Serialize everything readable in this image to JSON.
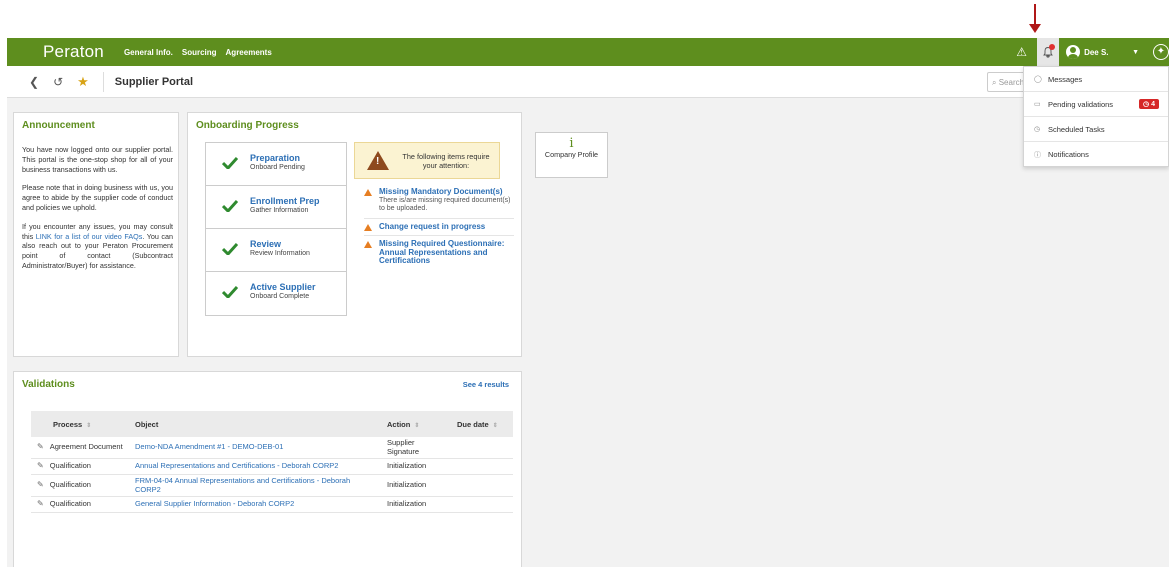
{
  "annotation": {
    "arrow_color": "#b01818"
  },
  "header": {
    "brand": "Peraton",
    "nav": [
      "General Info.",
      "Sourcing",
      "Agreements"
    ],
    "user_name": "Dee S.",
    "accent": "#5e8e1e"
  },
  "subbar": {
    "title": "Supplier Portal",
    "search_placeholder": "Search"
  },
  "announcement": {
    "title": "Announcement",
    "p1": "You have now logged onto our supplier portal. This portal is the one-stop shop for all of your business transactions with us.",
    "p2": "Please note that in doing business with us, you agree to abide by the supplier code of conduct and policies we uphold.",
    "p3_before": "If you encounter any issues, you may consult this ",
    "p3_link": "LINK for a list of our video FAQs",
    "p3_after": ". You can also reach out to your Peraton Procurement point of contact (Subcontract Administrator/Buyer) for assistance."
  },
  "onboarding": {
    "title": "Onboarding Progress",
    "steps": [
      {
        "name": "Preparation",
        "sub": "Onboard Pending"
      },
      {
        "name": "Enrollment Prep",
        "sub": "Gather Information"
      },
      {
        "name": "Review",
        "sub": "Review Information"
      },
      {
        "name": "Active Supplier",
        "sub": "Onboard Complete"
      }
    ],
    "attention_text": "The following items require your attention:",
    "attention_items": [
      {
        "title": "Missing Mandatory Document(s)",
        "desc": "There is/are missing required document(s) to be uploaded."
      },
      {
        "title": "Change request in progress",
        "desc": ""
      },
      {
        "title": "Missing Required Questionnaire: Annual Representations and Certifications",
        "desc": ""
      }
    ]
  },
  "company_profile": {
    "label": "Company Profile"
  },
  "validations": {
    "title": "Validations",
    "see_results": "See 4 results",
    "columns": [
      "Process",
      "Object",
      "Action",
      "Due date"
    ],
    "rows": [
      {
        "process": "Agreement Document",
        "object": "Demo-NDA Amendment #1 - DEMO-DEB-01",
        "action": "Supplier Signature",
        "due": ""
      },
      {
        "process": "Qualification",
        "object": "Annual Representations and Certifications - Deborah CORP2",
        "action": "Initialization",
        "due": ""
      },
      {
        "process": "Qualification",
        "object": "FRM-04-04 Annual Representations and Certifications - Deborah CORP2",
        "action": "Initialization",
        "due": ""
      },
      {
        "process": "Qualification",
        "object": "General Supplier Information - Deborah CORP2",
        "action": "Initialization",
        "due": ""
      }
    ]
  },
  "dropdown": {
    "items": [
      {
        "label": "Messages",
        "badge": ""
      },
      {
        "label": "Pending validations",
        "badge": "4"
      },
      {
        "label": "Scheduled Tasks",
        "badge": ""
      },
      {
        "label": "Notifications",
        "badge": ""
      }
    ]
  }
}
